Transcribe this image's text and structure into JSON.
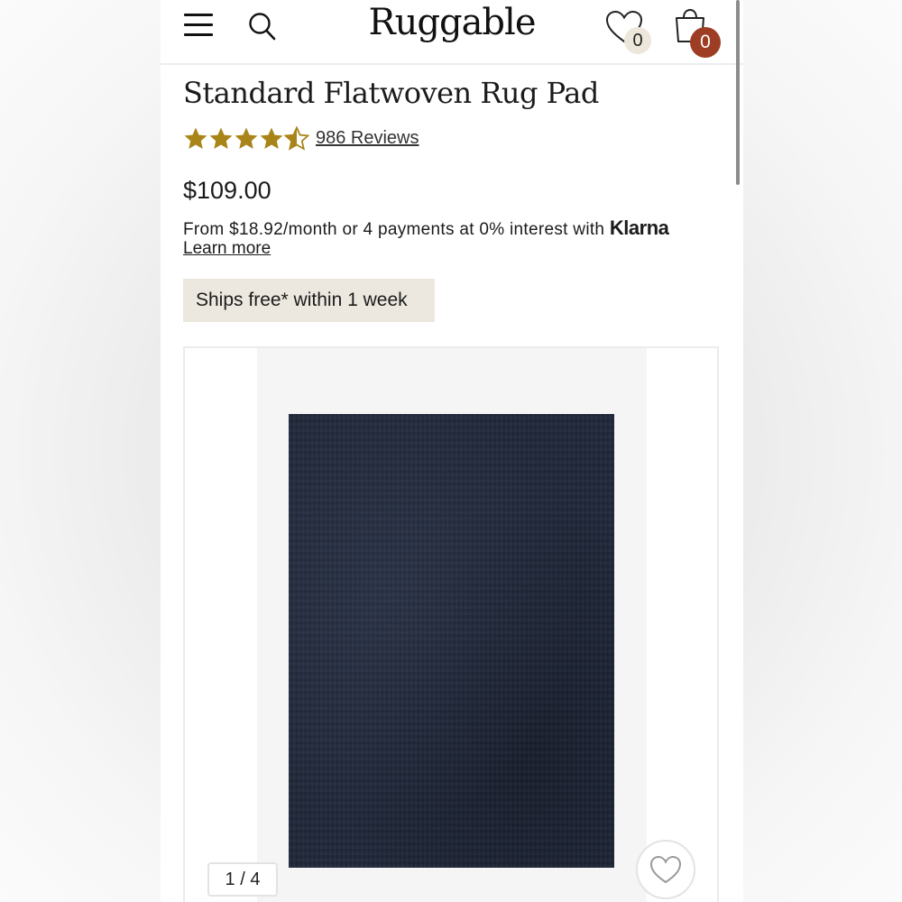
{
  "header": {
    "logo": "Ruggable",
    "wishlist_count": "0",
    "cart_count": "0",
    "icons": [
      "menu-icon",
      "search-icon",
      "heart-icon",
      "shopping-bag-icon"
    ]
  },
  "product": {
    "title": "Standard Flatwoven Rug Pad",
    "rating": 4.5,
    "rating_max": 5,
    "reviews": "986 Reviews",
    "price": "$109.00",
    "financing_text": "From $18.92/month or 4 payments at 0% interest with",
    "financing_brand": "Klarna",
    "learn_more": "Learn more",
    "shipping_badge": "Ships free* within 1 week"
  },
  "gallery": {
    "counter": "1 / 4"
  },
  "colors": {
    "star": "#a98519",
    "cart_badge": "#9d3d23",
    "wishlist_badge": "#ece7da",
    "shipping_badge_bg": "#ece8df",
    "rug": "#20283a"
  }
}
